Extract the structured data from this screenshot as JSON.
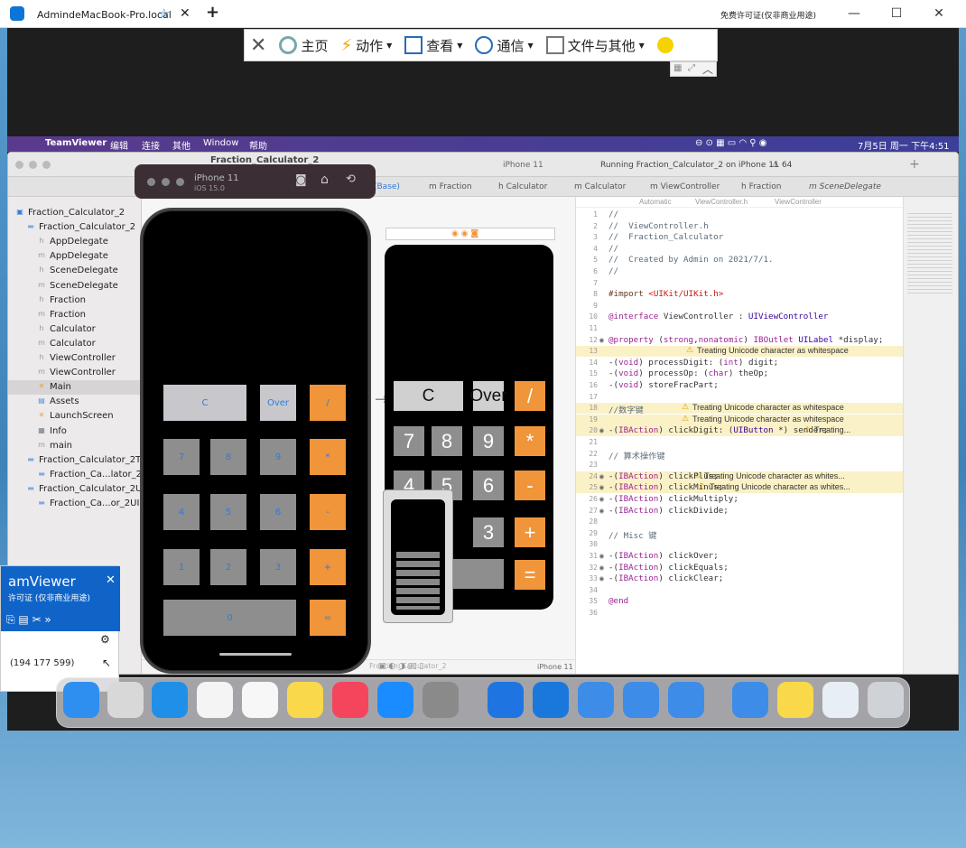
{
  "tv_window": {
    "tab_title": "AdmindeMacBook-Pro.local",
    "license_text": "免费许可证(仅非商业用途)",
    "toolbar": {
      "home": "主页",
      "actions": "动作",
      "view": "查看",
      "communicate": "通信",
      "files": "文件与其他"
    }
  },
  "mac_menubar": {
    "items": [
      "TeamViewer",
      "编辑",
      "连接",
      "其他",
      "Window",
      "帮助"
    ],
    "clock": "7月5日 周一 下午4:51"
  },
  "xcode": {
    "project_title": "Fraction_Calculator_2",
    "status": "Running Fraction_Calculator_2 on iPhone 11",
    "warning_count": "64",
    "scheme_device": "iPhone 11",
    "tabs": [
      "(Base)",
      "Fraction",
      "Calculator",
      "Calculator",
      "ViewController",
      "Fraction",
      "SceneDelegate"
    ],
    "navigator": [
      {
        "label": "Fraction_Calculator_2",
        "indent": 0,
        "icon": "project"
      },
      {
        "label": "Fraction_Calculator_2",
        "indent": 1,
        "icon": "folder"
      },
      {
        "label": "AppDelegate",
        "indent": 2,
        "icon": "h"
      },
      {
        "label": "AppDelegate",
        "indent": 2,
        "icon": "m"
      },
      {
        "label": "SceneDelegate",
        "indent": 2,
        "icon": "h"
      },
      {
        "label": "SceneDelegate",
        "indent": 2,
        "icon": "m"
      },
      {
        "label": "Fraction",
        "indent": 2,
        "icon": "h"
      },
      {
        "label": "Fraction",
        "indent": 2,
        "icon": "m"
      },
      {
        "label": "Calculator",
        "indent": 2,
        "icon": "h"
      },
      {
        "label": "Calculator",
        "indent": 2,
        "icon": "m"
      },
      {
        "label": "ViewController",
        "indent": 2,
        "icon": "h"
      },
      {
        "label": "ViewController",
        "indent": 2,
        "icon": "m"
      },
      {
        "label": "Main",
        "indent": 2,
        "icon": "x",
        "selected": true
      },
      {
        "label": "Assets",
        "indent": 2,
        "icon": "a"
      },
      {
        "label": "LaunchScreen",
        "indent": 2,
        "icon": "x"
      },
      {
        "label": "Info",
        "indent": 2,
        "icon": "i"
      },
      {
        "label": "main",
        "indent": 2,
        "icon": "m"
      },
      {
        "label": "Fraction_Calculator_2T...",
        "indent": 1,
        "icon": "folder"
      },
      {
        "label": "Fraction_Ca...lator_2...",
        "indent": 2,
        "icon": "f"
      },
      {
        "label": "Fraction_Calculator_2U...",
        "indent": 1,
        "icon": "folder"
      },
      {
        "label": "Fraction_Ca...or_2UI...",
        "indent": 2,
        "icon": "f"
      }
    ],
    "editor_breadcrumb": [
      "Automatic",
      "ViewController.h",
      "ViewController"
    ],
    "editor_page": "2",
    "ib_device": "iPhone 11",
    "bottom_filter": "Fraction_Calculator_2",
    "code_lines": [
      {
        "n": "1",
        "t": "//"
      },
      {
        "n": "2",
        "t": "//  ViewController.h"
      },
      {
        "n": "3",
        "t": "//  Fraction_Calculator"
      },
      {
        "n": "4",
        "t": "//"
      },
      {
        "n": "5",
        "t": "//  Created by Admin on 2021/7/1."
      },
      {
        "n": "6",
        "t": "//"
      },
      {
        "n": "7",
        "t": ""
      },
      {
        "n": "8",
        "t": "#import <UIKit/UIKit.h>"
      },
      {
        "n": "9",
        "t": ""
      },
      {
        "n": "10",
        "t": "@interface ViewController : UIViewController"
      },
      {
        "n": "11",
        "t": ""
      },
      {
        "n": "12",
        "t": "@property (strong,nonatomic) IBOutlet UILabel *display;"
      },
      {
        "n": "13",
        "t": ""
      },
      {
        "n": "14",
        "t": "-(void) processDigit: (int) digit;"
      },
      {
        "n": "15",
        "t": "-(void) processOp: (char) theOp;"
      },
      {
        "n": "16",
        "t": "-(void) storeFracPart;"
      },
      {
        "n": "17",
        "t": ""
      },
      {
        "n": "18",
        "t": "//数字键"
      },
      {
        "n": "19",
        "t": ""
      },
      {
        "n": "20",
        "t": "-(IBAction) clickDigit: (UIButton *) sender;"
      },
      {
        "n": "21",
        "t": ""
      },
      {
        "n": "22",
        "t": "// 算术操作键"
      },
      {
        "n": "23",
        "t": ""
      },
      {
        "n": "24",
        "t": "-(IBAction) clickPlus;"
      },
      {
        "n": "25",
        "t": "-(IBAction) clickMinus;"
      },
      {
        "n": "26",
        "t": "-(IBAction) clickMultiply;"
      },
      {
        "n": "27",
        "t": "-(IBAction) clickDivide;"
      },
      {
        "n": "28",
        "t": ""
      },
      {
        "n": "29",
        "t": "// Misc 键"
      },
      {
        "n": "30",
        "t": ""
      },
      {
        "n": "31",
        "t": "-(IBAction) clickOver;"
      },
      {
        "n": "32",
        "t": "-(IBAction) clickEquals;"
      },
      {
        "n": "33",
        "t": "-(IBAction) clickClear;"
      },
      {
        "n": "34",
        "t": ""
      },
      {
        "n": "35",
        "t": "@end"
      },
      {
        "n": "36",
        "t": ""
      }
    ],
    "warning_text": "Treating Unicode character as whitespace",
    "warning_short": "Treating...",
    "warning_trunc": "Treating Unicode character as whites..."
  },
  "simulator": {
    "device": "iPhone 11",
    "os": "iOS 15.0",
    "keys": [
      "C",
      "Over",
      "/",
      "7",
      "8",
      "9",
      "*",
      "4",
      "5",
      "6",
      "-",
      "1",
      "2",
      "3",
      "+",
      "0",
      "="
    ]
  },
  "storyboard_keys": [
    "C",
    "Over",
    "/",
    "7",
    "8",
    "9",
    "*",
    "4",
    "5",
    "6",
    "-",
    "3",
    "+",
    "="
  ],
  "tv_panel": {
    "title": "amViewer",
    "license": "许可证 (仅非商业用途)",
    "id": "(194 177 599)"
  }
}
